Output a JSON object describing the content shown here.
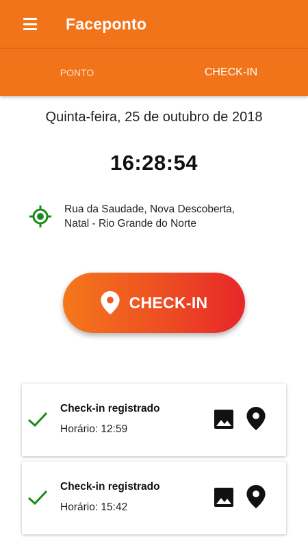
{
  "app": {
    "title": "Faceponto"
  },
  "tabs": [
    {
      "label": "PONTO",
      "active": false
    },
    {
      "label": "CHECK-IN",
      "active": true
    }
  ],
  "main": {
    "date": "Quinta-feira, 25 de outubro de 2018",
    "time": "16:28:54",
    "location": {
      "line1": "Rua da Saudade, Nova Descoberta,",
      "line2": "Natal - Rio Grande do Norte",
      "icon": "gps-target-icon",
      "color": "#1a8a1a"
    },
    "checkin_button": {
      "label": "CHECK-IN",
      "icon": "location-pin-icon"
    }
  },
  "history": [
    {
      "title": "Check-in registrado",
      "time_label": "Horário: 12:59"
    },
    {
      "title": "Check-in registrado",
      "time_label": "Horário: 15:42"
    }
  ],
  "colors": {
    "primary": "#f2741a",
    "gradient_end": "#e82628",
    "success": "#1a8a1a"
  }
}
